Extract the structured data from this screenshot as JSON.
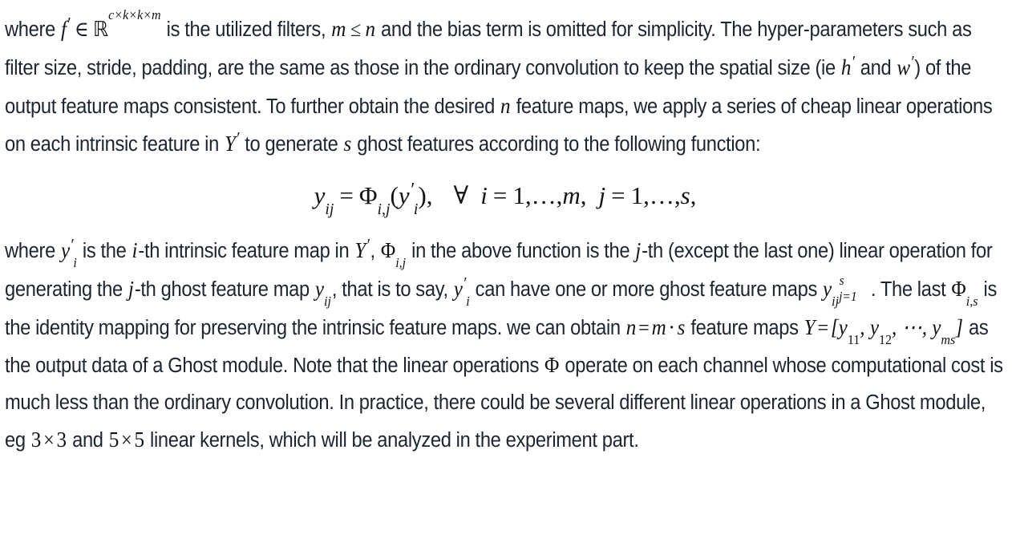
{
  "document": {
    "type": "paper-excerpt",
    "background_color": "#ffffff",
    "text_color": "#1b2430",
    "math_color": "#141414"
  },
  "paragraph_1": {
    "t1": "where ",
    "math_f_prime": "f",
    "math_in": "∈",
    "math_R": "ℝ",
    "math_R_exp": "c×k×k×m",
    "t2": " is the utilized filters, ",
    "math_m": "m",
    "math_le": "≤",
    "math_n": "n",
    "t3": " and the bias term is omitted for simplicity. The hyper-parameters such as filter size, stride, padding, are the same as those in the ordinary convolution to keep the spatial size (ie ",
    "math_h": "h",
    "t4": " and ",
    "math_w": "w",
    "t5": ") of the output feature maps consistent. To further obtain the desired ",
    "math_n2": "n",
    "t6": " feature maps, we apply a series of cheap linear operations on each intrinsic feature in ",
    "math_Y": "Y",
    "t7": " to generate ",
    "math_s": "s",
    "t8": " ghost features according to the following function:",
    "prime": "′"
  },
  "equation": {
    "label": "ghost-feature-equation",
    "lhs_var": "y",
    "lhs_sub": "ij",
    "eq": "=",
    "phi": "Φ",
    "phi_sub": "i,j",
    "open_paren": "(",
    "arg_var": "y",
    "arg_prime": "′",
    "arg_sub": "i",
    "close_paren": ")",
    "comma1": ",",
    "forall": "∀",
    "i_var": "i",
    "i_eq": "=",
    "i_start": "1",
    "i_dots": ",…,",
    "i_end": "m",
    "comma2": ",",
    "j_var": "j",
    "j_eq": "=",
    "j_start": "1",
    "j_dots": ",…,",
    "j_end": "s",
    "comma3": ","
  },
  "paragraph_2": {
    "t1": "where ",
    "math_y_prime_i": "y",
    "t2": " is the ",
    "math_i": "i",
    "t3": "-th intrinsic feature map in ",
    "math_Y": "Y",
    "t4": ", ",
    "math_Phi": "Φ",
    "math_Phi_sub": "i,j",
    "t5": " in the above function is the ",
    "math_j": "j",
    "t6": "-th (except the last one) linear operation for generating the ",
    "math_j2": "j",
    "t7": "-th ghost feature map ",
    "math_y_ij": "y",
    "math_y_ij_sub": "ij",
    "t8": ", that is to say, ",
    "math_y_prime_i2": "y",
    "t9": " can have one or more ghost feature maps ",
    "math_set_var": "y",
    "math_set_sub": "ij",
    "math_set_sup": "s",
    "math_set_bot": "j=1",
    "t10": ". The last ",
    "math_Phi_is": "Φ",
    "math_Phi_is_sub": "i,s",
    "t11": " is the identity mapping for preserving the intrinsic feature maps. we can obtain ",
    "math_n": "n",
    "math_eq": "=",
    "math_m": "m",
    "math_cdot": "⋅",
    "math_s": "s",
    "t12": " feature maps ",
    "math_Y2": "Y",
    "math_eq2": "=",
    "math_bracket_open": "[",
    "math_y11": "y",
    "math_y11_sub": "11",
    "math_comma1": ",",
    "math_y12": "y",
    "math_y12_sub": "12",
    "math_comma2": ",",
    "math_cdots": "⋯",
    "math_comma3": ",",
    "math_yms": "y",
    "math_yms_sub": "ms",
    "math_bracket_close": "]",
    "t13": " as the output data of a Ghost module. Note that the linear operations ",
    "math_Phi_plain": "Φ",
    "t14": " operate on each channel whose computational cost is much less than the ordinary convolution. In practice, there could be several different linear operations in a Ghost module, eg ",
    "math_3a": "3",
    "math_times1": "×",
    "math_3b": "3",
    "t15": " and ",
    "math_5a": "5",
    "math_times2": "×",
    "math_5b": "5",
    "t16": " linear kernels, which will be analyzed in the experiment part.",
    "prime": "′"
  }
}
